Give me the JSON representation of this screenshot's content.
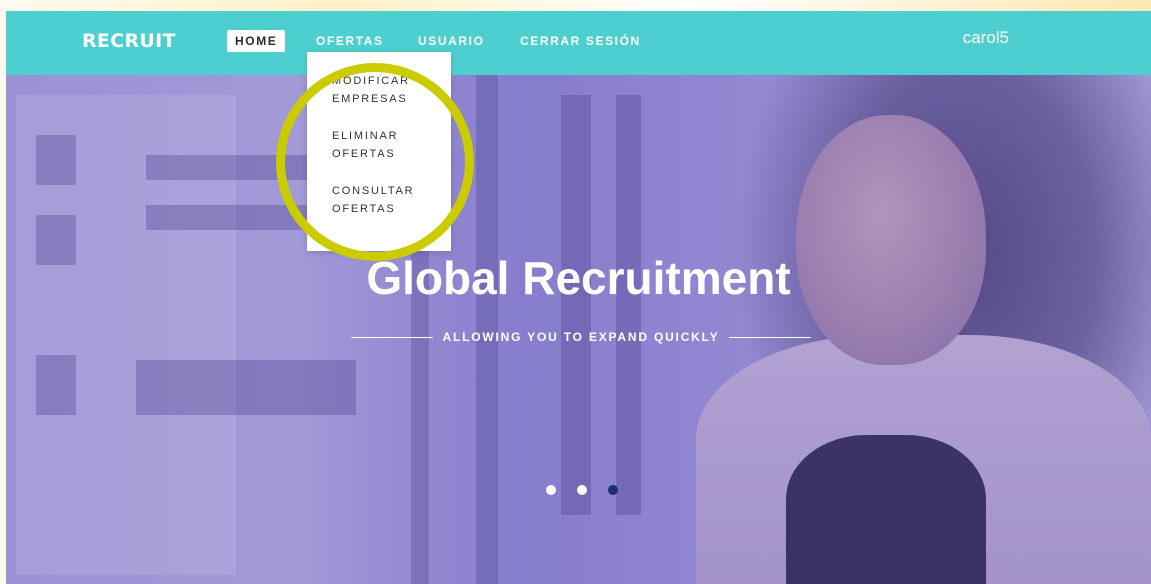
{
  "navbar": {
    "brand": "RECRUIT",
    "items": [
      {
        "label": "HOME",
        "active": true
      },
      {
        "label": "OFERTAS",
        "active": false
      },
      {
        "label": "USUARIO",
        "active": false
      },
      {
        "label": "CERRAR SESIÓN",
        "active": false
      }
    ],
    "user": "carol5",
    "color": "#4ecfcf"
  },
  "dropdown": {
    "items": [
      {
        "label": "MODIFICAR EMPRESAS"
      },
      {
        "label": "ELIMINAR OFERTAS"
      },
      {
        "label": "CONSULTAR OFERTAS"
      }
    ]
  },
  "hero": {
    "title": "Global Recruitment",
    "tagline": "ALLOWING YOU TO EXPAND QUICKLY"
  },
  "carousel": {
    "slide_count": 3,
    "active_index": 2,
    "active_color": "#1d2e6b"
  },
  "annotation": {
    "highlight_color": "#cbcc00"
  }
}
